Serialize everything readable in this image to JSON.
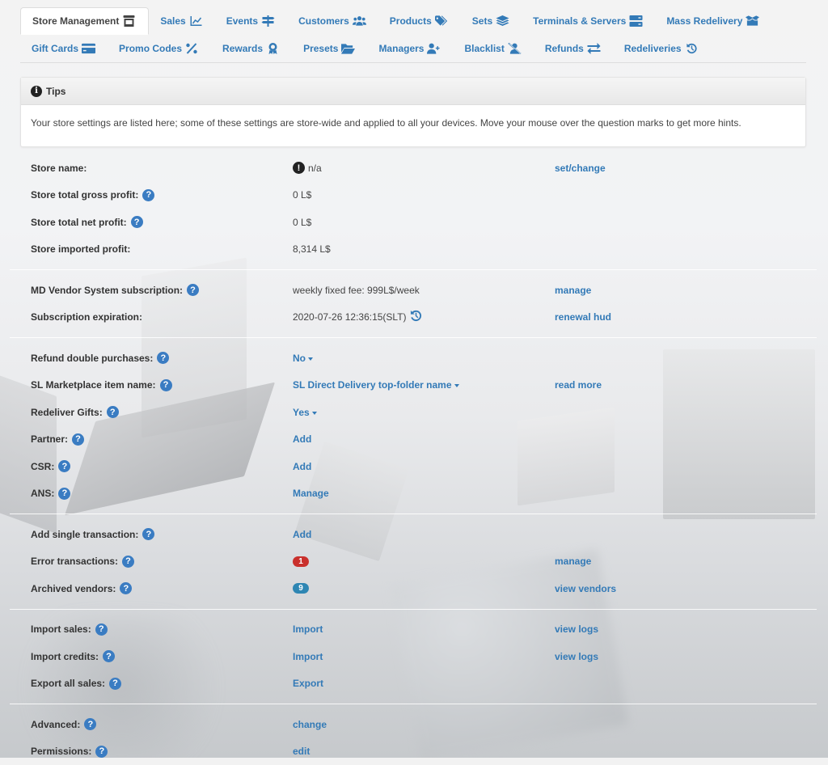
{
  "tabs": {
    "row1": [
      {
        "label": "Store Management",
        "icon": "store-icon",
        "active": true
      },
      {
        "label": "Sales",
        "icon": "chart-line-icon"
      },
      {
        "label": "Events",
        "icon": "signpost-icon"
      },
      {
        "label": "Customers",
        "icon": "users-icon"
      },
      {
        "label": "Products",
        "icon": "tags-icon"
      },
      {
        "label": "Sets",
        "icon": "layer-group-icon"
      },
      {
        "label": "Terminals & Servers",
        "icon": "server-icon"
      },
      {
        "label": "Mass Redelivery",
        "icon": "box-open-icon"
      }
    ],
    "row2": [
      {
        "label": "Gift Cards",
        "icon": "credit-card-icon"
      },
      {
        "label": "Promo Codes",
        "icon": "percent-icon"
      },
      {
        "label": "Rewards",
        "icon": "award-icon"
      },
      {
        "label": "Presets",
        "icon": "folder-open-icon"
      },
      {
        "label": "Managers",
        "icon": "user-plus-icon"
      },
      {
        "label": "Blacklist",
        "icon": "user-slash-icon"
      },
      {
        "label": "Refunds",
        "icon": "exchange-icon"
      },
      {
        "label": "Redeliveries",
        "icon": "history-icon"
      }
    ]
  },
  "tips": {
    "title": "Tips",
    "body": "Your store settings are listed here; some of these settings are store-wide and applied to all your devices. Move your mouse over the question marks to get more hints."
  },
  "settings": {
    "store_name": {
      "label": "Store name:",
      "value": "n/a",
      "action": "set/change"
    },
    "gross_profit": {
      "label": "Store total gross profit:",
      "value": "0 L$"
    },
    "net_profit": {
      "label": "Store total net profit:",
      "value": "0 L$"
    },
    "imported_profit": {
      "label": "Store imported profit:",
      "value": "8,314 L$"
    },
    "subscription": {
      "label": "MD Vendor System subscription:",
      "value": "weekly fixed fee: 999L$/week",
      "action": "manage"
    },
    "expiration": {
      "label": "Subscription expiration:",
      "value": "2020-07-26 12:36:15(SLT)",
      "action": "renewal hud"
    },
    "refund_double": {
      "label": "Refund double purchases:",
      "value": "No"
    },
    "sl_marketplace": {
      "label": "SL Marketplace item name:",
      "value": "SL Direct Delivery top-folder name",
      "action": "read more"
    },
    "redeliver_gifts": {
      "label": "Redeliver Gifts:",
      "value": "Yes"
    },
    "partner": {
      "label": "Partner:",
      "value": "Add"
    },
    "csr": {
      "label": "CSR:",
      "value": "Add"
    },
    "ans": {
      "label": "ANS:",
      "value": "Manage"
    },
    "add_transaction": {
      "label": "Add single transaction:",
      "value": "Add"
    },
    "error_transactions": {
      "label": "Error transactions:",
      "count": "1",
      "action": "manage"
    },
    "archived_vendors": {
      "label": "Archived vendors:",
      "count": "9",
      "action": "view vendors"
    },
    "import_sales": {
      "label": "Import sales:",
      "value": "Import",
      "action": "view logs"
    },
    "import_credits": {
      "label": "Import credits:",
      "value": "Import",
      "action": "view logs"
    },
    "export_sales": {
      "label": "Export all sales:",
      "value": "Export"
    },
    "advanced": {
      "label": "Advanced:",
      "value": "change"
    },
    "permissions": {
      "label": "Permissions:",
      "value": "edit"
    }
  },
  "help_glyph": "?",
  "colors": {
    "link": "#337ab7",
    "help": "#3a7cc2",
    "badge_error": "#c9302c",
    "badge_info": "#2e86b3"
  }
}
